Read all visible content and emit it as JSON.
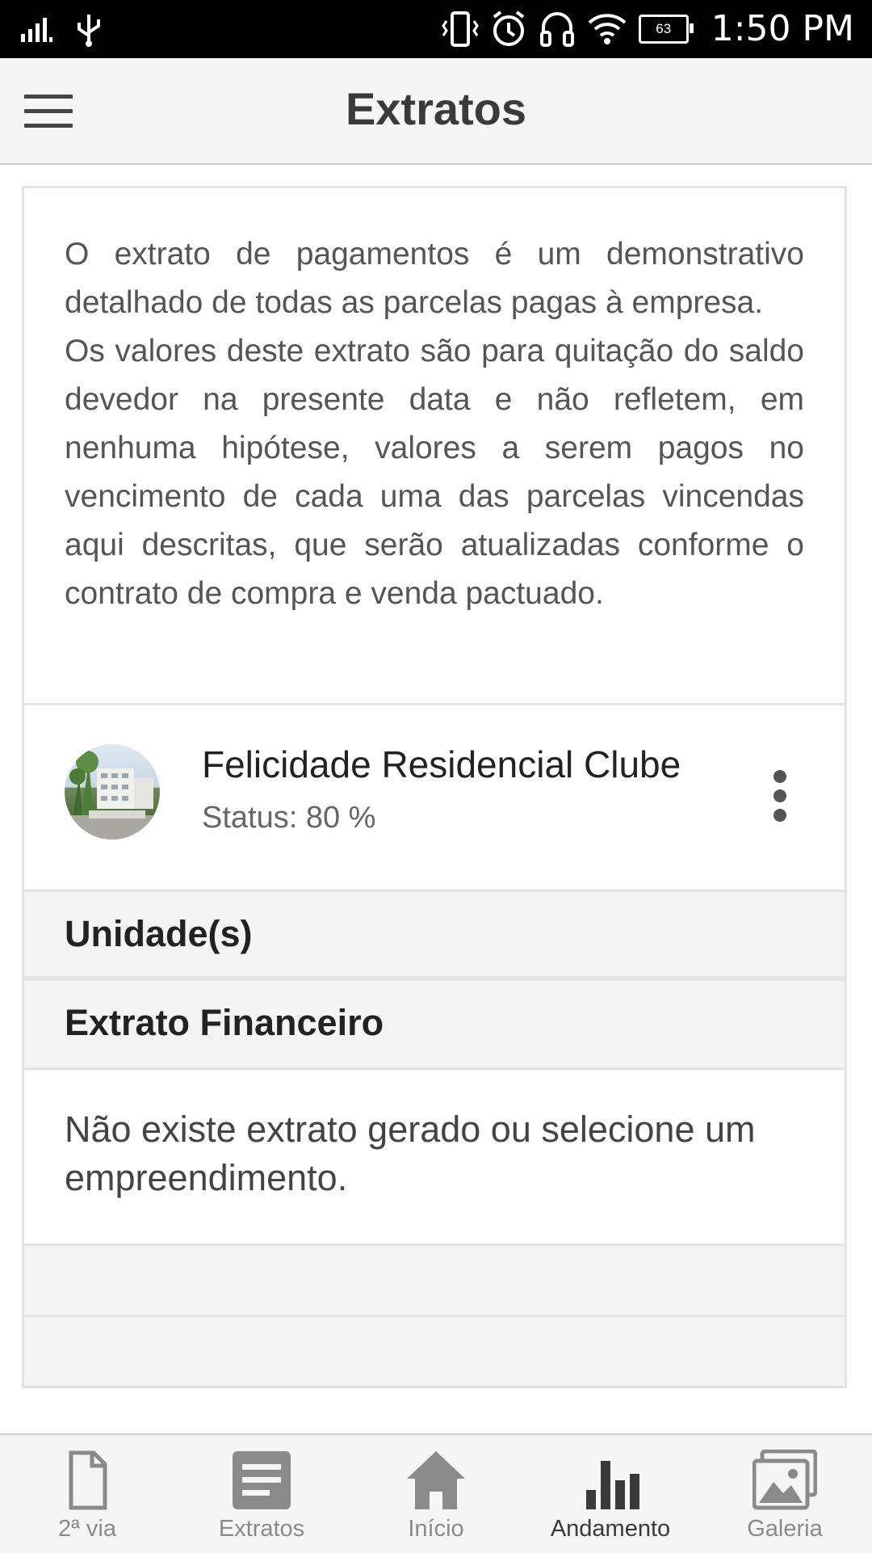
{
  "status_bar": {
    "time": "1:50 PM",
    "battery_level": "63",
    "icons": [
      "signal-icon",
      "usb-icon",
      "vibrate-icon",
      "alarm-icon",
      "headset-icon",
      "wifi-icon",
      "battery-icon"
    ]
  },
  "appbar": {
    "title": "Extratos",
    "menu_icon": "hamburger-menu-icon"
  },
  "intro": {
    "paragraph_1": "O extrato de pagamentos é um demonstrativo detalhado de todas as parcelas pagas à empresa.",
    "paragraph_2": "Os valores deste extrato são para quitação do saldo devedor na presente data e não refletem, em nenhuma hipótese, valores a serem pagos no vencimento de cada uma das parcelas vincendas aqui descritas, que serão atualizadas conforme o contrato de compra e venda pactuado."
  },
  "project": {
    "name": "Felicidade Residencial Clube",
    "status": "Status: 80 %",
    "avatar_icon": "building-photo",
    "menu_icon": "more-vertical-icon"
  },
  "sections": {
    "units_label": "Unidade(s)",
    "financial_label": "Extrato Financeiro",
    "empty_message": "Não existe extrato gerado ou selecione um empreendimento."
  },
  "bottom_nav": {
    "items": [
      {
        "label": "2ª via",
        "icon": "document-icon"
      },
      {
        "label": "Extratos",
        "icon": "statement-icon"
      },
      {
        "label": "Início",
        "icon": "home-icon"
      },
      {
        "label": "Andamento",
        "icon": "bar-chart-icon"
      },
      {
        "label": "Galeria",
        "icon": "gallery-icon"
      }
    ],
    "active": "Andamento"
  },
  "colors": {
    "appbar_bg": "#f5f5f5",
    "section_bg": "#f3f3f3",
    "border": "#e3e3e3",
    "icon_gray": "#8a8a8a",
    "active_gray": "#3a3a3a"
  }
}
